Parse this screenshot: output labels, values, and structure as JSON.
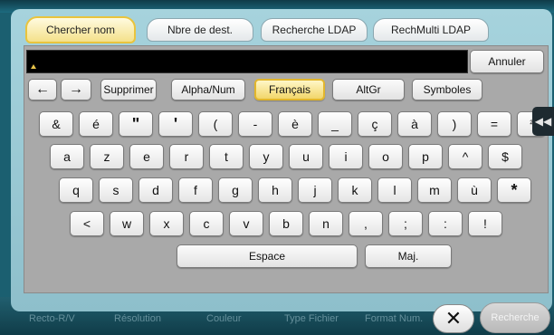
{
  "tabs": [
    {
      "label": "Chercher nom",
      "active": true
    },
    {
      "label": "Nbre de dest.",
      "active": false
    },
    {
      "label": "Recherche LDAP",
      "active": false
    },
    {
      "label": "RechMulti LDAP",
      "active": false
    }
  ],
  "input": {
    "value": ""
  },
  "buttons": {
    "cancel": "Annuler",
    "left_arrow": "←",
    "right_arrow": "→",
    "delete": "Supprimer",
    "alpha_num": "Alpha/Num",
    "french": "Français",
    "altgr": "AltGr",
    "symbols": "Symboles",
    "close": "✕",
    "search": "Recherche"
  },
  "keyboard": {
    "row1": [
      "&",
      "é",
      "\"",
      "'",
      "(",
      "-",
      "è",
      "_",
      "ç",
      "à",
      ")",
      "=",
      "²"
    ],
    "row2": [
      "a",
      "z",
      "e",
      "r",
      "t",
      "y",
      "u",
      "i",
      "o",
      "p",
      "^",
      "$"
    ],
    "row3": [
      "q",
      "s",
      "d",
      "f",
      "g",
      "h",
      "j",
      "k",
      "l",
      "m",
      "ù",
      "*"
    ],
    "row4": [
      "<",
      "w",
      "x",
      "c",
      "v",
      "b",
      "n",
      ",",
      ";",
      ":",
      "!"
    ],
    "space": "Espace",
    "shift": "Maj."
  },
  "side_tab_icon": "◀◀",
  "background_labels": [
    "Recto-R/V",
    "Résolution",
    "Couleur",
    "Type Fichier",
    "Format Num."
  ],
  "colors": {
    "active_tab_border": "#e9c43d",
    "active_key": "#f2d66a",
    "dialog_bg": "#9fcbd6",
    "panel_bg": "#a9a9a9"
  }
}
